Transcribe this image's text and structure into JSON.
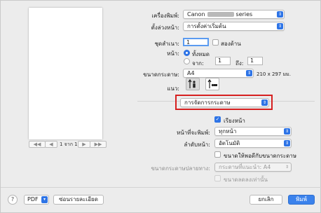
{
  "printer": {
    "label": "เครื่องพิมพ์:",
    "value_prefix": "Canon",
    "value_suffix": "series"
  },
  "presets": {
    "label": "ตั้งล่วงหน้า:",
    "value": "การตั้งค่าเริ่มต้น"
  },
  "copies": {
    "label": "ชุดสำเนา:",
    "value": "1",
    "two_sided_label": "สองด้าน"
  },
  "pages": {
    "label": "หน้า:",
    "all_label": "ทั้งหมด",
    "from_label": "จาก:",
    "from_value": "1",
    "to_label": "ถึง:",
    "to_value": "1"
  },
  "paper_size": {
    "label": "ขนาดกระดาษ:",
    "value": "A4",
    "dimensions": "210 x 297 มม."
  },
  "orientation": {
    "label": "แนว:"
  },
  "section_menu": {
    "value": "การจัดการกระดาษ"
  },
  "paper_handling": {
    "collate_label": "เรียงหน้า",
    "pages_to_print_label": "หน้าที่จะพิมพ์:",
    "pages_to_print_value": "ทุกหน้า",
    "page_order_label": "ลำดับหน้า:",
    "page_order_value": "อัตโนมัติ",
    "scale_to_fit_label": "ขนาดให้พอดีกับขนาดกระดาษ",
    "destination_label": "ขนาดกระดาษปลายทาง:",
    "destination_value": "กระดาษที่แนะนำ: A4",
    "scale_down_only_label": "ขนาดลดลงเท่านั้น"
  },
  "preview": {
    "page_label": "1 จาก 1",
    "first_label": "◀◀",
    "prev_label": "◀",
    "next_label": "▶",
    "last_label": "▶▶"
  },
  "bottom": {
    "help_label": "?",
    "pdf_label": "PDF",
    "hide_details_label": "ซ่อนรายละเอียด",
    "cancel_label": "ยกเลิก",
    "print_label": "พิมพ์"
  },
  "colors": {
    "accent": "#2e74e6",
    "highlight_border": "#d62020"
  },
  "icons": {
    "stepper": "up-down-chevron-icon",
    "portrait": "portrait-orientation-icon",
    "landscape": "landscape-orientation-icon"
  }
}
